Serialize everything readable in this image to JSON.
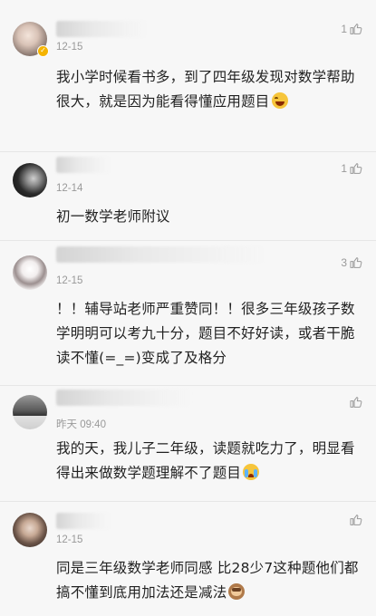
{
  "comments": [
    {
      "time": "12-15",
      "text": "我小学时候看书多，到了四年级发现对数学帮助很大，就是因为能看得懂应用题目",
      "emoji": "laughing-emoji",
      "likes": "1",
      "verified": true
    },
    {
      "time": "12-14",
      "text": "初一数学老师附议",
      "likes": "1"
    },
    {
      "time": "12-15",
      "text": "！！辅导站老师严重赞同！！很多三年级孩子数学明明可以考九十分，题目不好好读，或者干脆读不懂(=_=)变成了及格分",
      "likes": "3"
    },
    {
      "time": "昨天 09:40",
      "text": "我的天，我儿子二年级，读题就吃力了，明显看得出来做数学题理解不了题目",
      "emoji": "crying-emoji",
      "likes": ""
    },
    {
      "time": "12-15",
      "text": "同是三年级数学老师同感 比28少7这种题他们都搞不懂到底用加法还是减法",
      "emoji": "see-no-evil-monkey-emoji",
      "likes": ""
    }
  ],
  "colors": {
    "background": "#f7f7f7",
    "text": "#222222",
    "meta": "#999999",
    "verified": "#f5b400"
  },
  "icons": {
    "like": "thumbs-up-icon"
  }
}
